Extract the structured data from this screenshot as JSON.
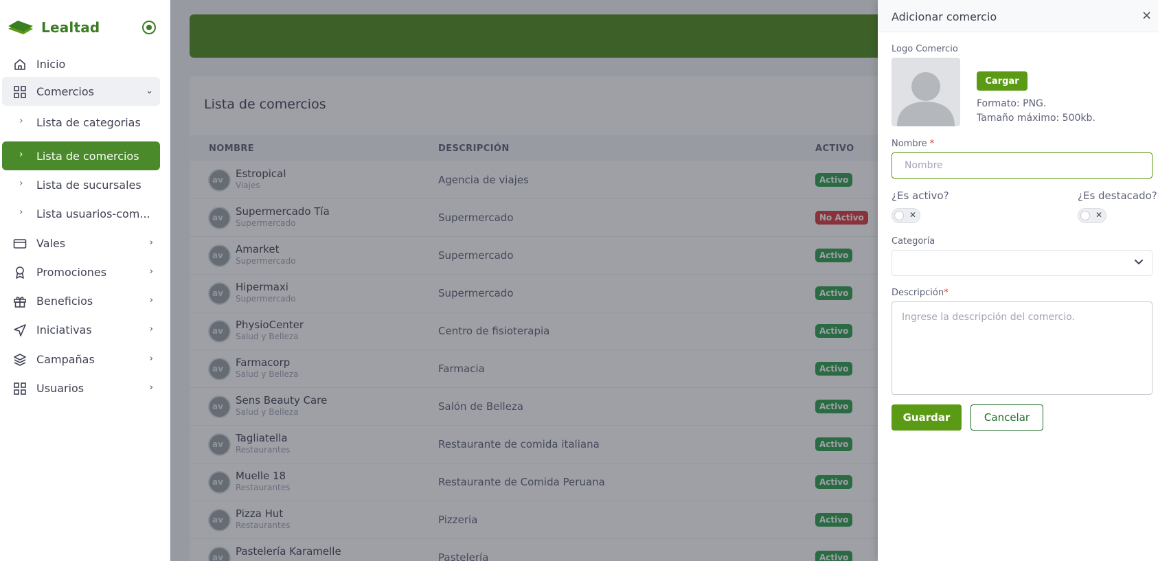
{
  "sidebar": {
    "brand": "Lealtad",
    "items": [
      {
        "label": "Inicio"
      },
      {
        "label": "Comercios",
        "chevron": "⌄"
      },
      {
        "label": "Vales",
        "chevron": "›"
      },
      {
        "label": "Promociones",
        "chevron": "›"
      },
      {
        "label": "Beneficios",
        "chevron": "›"
      },
      {
        "label": "Iniciativas",
        "chevron": "›"
      },
      {
        "label": "Campañas",
        "chevron": "›"
      },
      {
        "label": "Usuarios",
        "chevron": "›"
      }
    ],
    "subitems": [
      {
        "label": "Lista de categorias"
      },
      {
        "label": "Lista de comercios"
      },
      {
        "label": "Lista de sucursales"
      },
      {
        "label": "Lista usuarios-com..."
      }
    ],
    "bullet": "›"
  },
  "main": {
    "title": "Lista de comercios",
    "columns": [
      "NOMBRE",
      "DESCRIPCIÓN",
      "ACTIVO"
    ],
    "avatar_text": "av",
    "rows": [
      {
        "name": "Estropical",
        "category": "Viajes",
        "description": "Agencia de viajes",
        "status": "Activo"
      },
      {
        "name": "Supermercado Tía",
        "category": "Supermercado",
        "description": "Supermercado",
        "status": "No Activo"
      },
      {
        "name": "Amarket",
        "category": "Supermercado",
        "description": "Supermercado",
        "status": "Activo"
      },
      {
        "name": "Hipermaxi",
        "category": "Supermercado",
        "description": "Supermercado",
        "status": "Activo"
      },
      {
        "name": "PhysioCenter",
        "category": "Salud y Belleza",
        "description": "Centro de fisioterapia",
        "status": "Activo"
      },
      {
        "name": "Farmacorp",
        "category": "Salud y Belleza",
        "description": "Farmacia",
        "status": "Activo"
      },
      {
        "name": "Sens Beauty Care",
        "category": "Salud y Belleza",
        "description": "Salón de Belleza",
        "status": "Activo"
      },
      {
        "name": "Tagliatella",
        "category": "Restaurantes",
        "description": "Restaurante de comida italiana",
        "status": "Activo"
      },
      {
        "name": "Muelle 18",
        "category": "Restaurantes",
        "description": "Restaurante de Comida Peruana",
        "status": "Activo"
      },
      {
        "name": "Pizza Hut",
        "category": "Restaurantes",
        "description": "Pizzeria",
        "status": "Activo"
      },
      {
        "name": "Pastelería Karamelle",
        "category": "",
        "description": "Pastelería",
        "status": "Activo"
      }
    ]
  },
  "drawer": {
    "title": "Adicionar comercio",
    "close": "×",
    "logo_label": "Logo Comercio",
    "upload_button": "Cargar",
    "format_hint": "Formato: PNG.",
    "size_hint": "Tamaño máximo: 500kb.",
    "name_label": "Nombre",
    "required_mark": "*",
    "name_placeholder": "Nombre",
    "name_value": "",
    "active_label": "¿Es activo?",
    "featured_label": "¿Es destacado?",
    "toggle_off_symbol": "✕",
    "active_value": false,
    "featured_value": false,
    "category_label": "Categoría",
    "category_value": "",
    "description_label": "Descripción",
    "description_placeholder": "Ingrese la descripción del comercio.",
    "save_button": "Guardar",
    "cancel_button": "Cancelar"
  },
  "colors": {
    "brand_green": "#3b7d23",
    "banner_green": "#4f8a1e",
    "button_green": "#5a9a14",
    "active_badge": "#2f9e4f",
    "inactive_badge": "#d9383f"
  },
  "icons": {
    "brand": "leaf-stack-logo",
    "toggle": "circle-dot-icon",
    "inicio": "home-icon",
    "comercios": "grid-icon",
    "vales": "card-icon",
    "promociones": "award-icon",
    "beneficios": "gift-icon",
    "iniciativas": "send-icon",
    "campanas": "layers-icon",
    "usuarios": "grid-icon",
    "close": "close-icon",
    "select": "chevron-down-icon"
  }
}
